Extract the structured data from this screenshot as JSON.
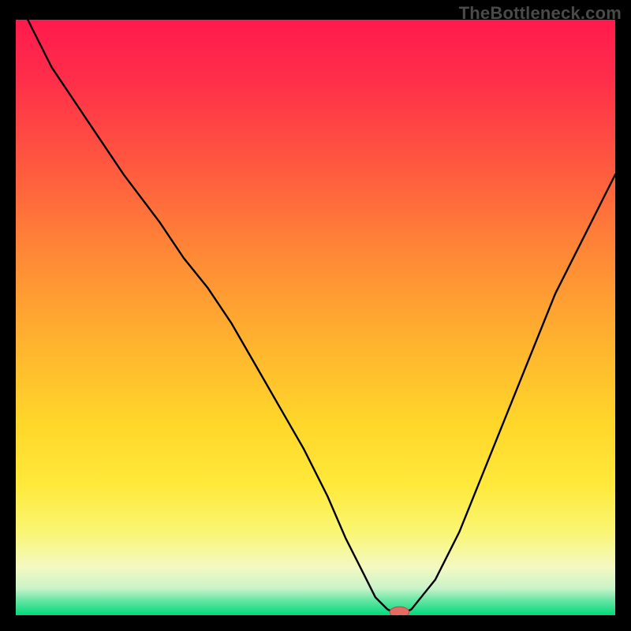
{
  "watermark": "TheBottleneck.com",
  "colors": {
    "frame_bg": "#000000",
    "gradient_stops": [
      {
        "offset": 0.0,
        "color": "#ff1a4d"
      },
      {
        "offset": 0.1,
        "color": "#ff2e4a"
      },
      {
        "offset": 0.25,
        "color": "#ff5a3f"
      },
      {
        "offset": 0.4,
        "color": "#ff8a36"
      },
      {
        "offset": 0.55,
        "color": "#ffb52e"
      },
      {
        "offset": 0.68,
        "color": "#ffd72a"
      },
      {
        "offset": 0.78,
        "color": "#ffe93a"
      },
      {
        "offset": 0.86,
        "color": "#faf673"
      },
      {
        "offset": 0.92,
        "color": "#f3f9c2"
      },
      {
        "offset": 0.955,
        "color": "#c9f3c9"
      },
      {
        "offset": 0.975,
        "color": "#66e6a3"
      },
      {
        "offset": 1.0,
        "color": "#00d97a"
      }
    ],
    "curve": "#000000",
    "marker_fill": "#e36b64",
    "marker_stroke": "#b84a45"
  },
  "chart_data": {
    "type": "line",
    "title": "",
    "xlabel": "",
    "ylabel": "",
    "xlim": [
      0,
      100
    ],
    "ylim": [
      0,
      100
    ],
    "notes": "Bottleneck-style V-curve over a vertical red→yellow→green gradient. Minimum at the marker position.",
    "series": [
      {
        "name": "curve",
        "x": [
          2,
          6,
          12,
          18,
          24,
          28,
          32,
          36,
          40,
          44,
          48,
          52,
          55,
          58,
          60,
          62,
          64,
          66,
          70,
          74,
          78,
          82,
          86,
          90,
          94,
          98,
          100
        ],
        "y": [
          100,
          92,
          83,
          74,
          66,
          60,
          55,
          49,
          42,
          35,
          28,
          20,
          13,
          7,
          3,
          1,
          0,
          1,
          6,
          14,
          24,
          34,
          44,
          54,
          62,
          70,
          74
        ]
      }
    ],
    "marker": {
      "x": 64,
      "y": 0,
      "rx": 1.6,
      "ry": 0.9
    }
  }
}
